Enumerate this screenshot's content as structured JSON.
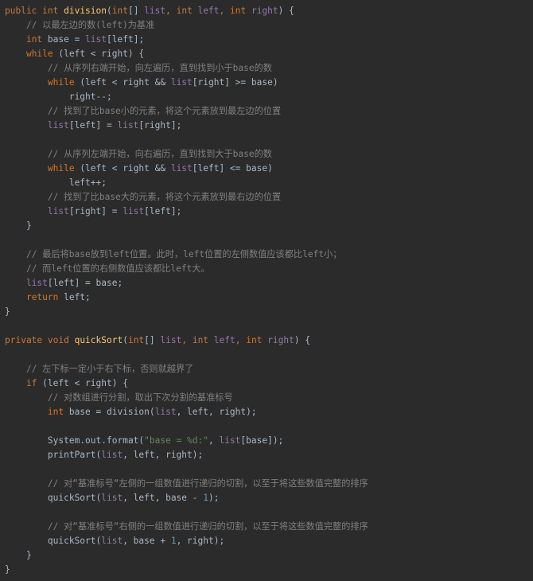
{
  "editor": {
    "lines": [
      {
        "indent": 0,
        "tokens": [
          {
            "t": "public ",
            "c": "kw"
          },
          {
            "t": "int ",
            "c": "kw"
          },
          {
            "t": "division",
            "c": "fn"
          },
          {
            "t": "(",
            "c": "punct"
          },
          {
            "t": "int",
            "c": "kw"
          },
          {
            "t": "[] ",
            "c": "punct"
          },
          {
            "t": "list",
            "c": "var"
          },
          {
            "t": ", ",
            "c": "kw"
          },
          {
            "t": "int ",
            "c": "kw"
          },
          {
            "t": "left",
            "c": "var"
          },
          {
            "t": ", ",
            "c": "kw"
          },
          {
            "t": "int ",
            "c": "kw"
          },
          {
            "t": "right",
            "c": "var"
          },
          {
            "t": ") {",
            "c": "punct"
          }
        ]
      },
      {
        "indent": 1,
        "tokens": [
          {
            "t": "// 以最左边的数(left)为基准",
            "c": "comment"
          }
        ]
      },
      {
        "indent": 1,
        "tokens": [
          {
            "t": "int ",
            "c": "kw"
          },
          {
            "t": "base = ",
            "c": "plain"
          },
          {
            "t": "list",
            "c": "var"
          },
          {
            "t": "[left];",
            "c": "plain"
          }
        ]
      },
      {
        "indent": 1,
        "tokens": [
          {
            "t": "while ",
            "c": "kw"
          },
          {
            "t": "(left < right) {",
            "c": "plain"
          }
        ]
      },
      {
        "indent": 2,
        "tokens": [
          {
            "t": "// 从序列右端开始，向左遍历，直到找到小于base的数",
            "c": "comment"
          }
        ]
      },
      {
        "indent": 2,
        "tokens": [
          {
            "t": "while ",
            "c": "kw"
          },
          {
            "t": "(left < right && ",
            "c": "plain"
          },
          {
            "t": "list",
            "c": "var"
          },
          {
            "t": "[right] >= base)",
            "c": "plain"
          }
        ]
      },
      {
        "indent": 3,
        "tokens": [
          {
            "t": "right--;",
            "c": "plain"
          }
        ]
      },
      {
        "indent": 2,
        "tokens": [
          {
            "t": "// 找到了比base小的元素，将这个元素放到最左边的位置",
            "c": "comment"
          }
        ]
      },
      {
        "indent": 2,
        "tokens": [
          {
            "t": "list",
            "c": "var"
          },
          {
            "t": "[left] = ",
            "c": "plain"
          },
          {
            "t": "list",
            "c": "var"
          },
          {
            "t": "[right];",
            "c": "plain"
          }
        ]
      },
      {
        "indent": 0,
        "tokens": []
      },
      {
        "indent": 2,
        "tokens": [
          {
            "t": "// 从序列左端开始，向右遍历，直到找到大于base的数",
            "c": "comment"
          }
        ]
      },
      {
        "indent": 2,
        "tokens": [
          {
            "t": "while ",
            "c": "kw"
          },
          {
            "t": "(left < right && ",
            "c": "plain"
          },
          {
            "t": "list",
            "c": "var"
          },
          {
            "t": "[left] <= base)",
            "c": "plain"
          }
        ]
      },
      {
        "indent": 3,
        "tokens": [
          {
            "t": "left++;",
            "c": "plain"
          }
        ]
      },
      {
        "indent": 2,
        "tokens": [
          {
            "t": "// 找到了比base大的元素，将这个元素放到最右边的位置",
            "c": "comment"
          }
        ]
      },
      {
        "indent": 2,
        "tokens": [
          {
            "t": "list",
            "c": "var"
          },
          {
            "t": "[right] = ",
            "c": "plain"
          },
          {
            "t": "list",
            "c": "var"
          },
          {
            "t": "[left];",
            "c": "plain"
          }
        ]
      },
      {
        "indent": 1,
        "tokens": [
          {
            "t": "}",
            "c": "plain"
          }
        ]
      },
      {
        "indent": 0,
        "tokens": []
      },
      {
        "indent": 1,
        "tokens": [
          {
            "t": "// 最后将base放到left位置。此时，left位置的左侧数值应该都比left小；",
            "c": "comment"
          }
        ]
      },
      {
        "indent": 1,
        "tokens": [
          {
            "t": "// 而left位置的右侧数值应该都比left大。",
            "c": "comment"
          }
        ]
      },
      {
        "indent": 1,
        "tokens": [
          {
            "t": "list",
            "c": "var"
          },
          {
            "t": "[left] = base;",
            "c": "plain"
          }
        ]
      },
      {
        "indent": 1,
        "tokens": [
          {
            "t": "return ",
            "c": "kw"
          },
          {
            "t": "left;",
            "c": "plain"
          }
        ]
      },
      {
        "indent": 0,
        "tokens": [
          {
            "t": "}",
            "c": "plain"
          }
        ]
      },
      {
        "indent": 0,
        "tokens": []
      },
      {
        "indent": 0,
        "tokens": [
          {
            "t": "private ",
            "c": "kw"
          },
          {
            "t": "void ",
            "c": "kw"
          },
          {
            "t": "quickSort",
            "c": "fn"
          },
          {
            "t": "(",
            "c": "punct"
          },
          {
            "t": "int",
            "c": "kw"
          },
          {
            "t": "[] ",
            "c": "punct"
          },
          {
            "t": "list",
            "c": "var"
          },
          {
            "t": ", ",
            "c": "kw"
          },
          {
            "t": "int ",
            "c": "kw"
          },
          {
            "t": "left",
            "c": "var"
          },
          {
            "t": ", ",
            "c": "kw"
          },
          {
            "t": "int ",
            "c": "kw"
          },
          {
            "t": "right",
            "c": "var"
          },
          {
            "t": ") {",
            "c": "punct"
          }
        ]
      },
      {
        "indent": 0,
        "tokens": []
      },
      {
        "indent": 1,
        "tokens": [
          {
            "t": "// 左下标一定小于右下标，否则就越界了",
            "c": "comment"
          }
        ]
      },
      {
        "indent": 1,
        "tokens": [
          {
            "t": "if ",
            "c": "kw"
          },
          {
            "t": "(left < right) {",
            "c": "plain"
          }
        ]
      },
      {
        "indent": 2,
        "tokens": [
          {
            "t": "// 对数组进行分割，取出下次分割的基准标号",
            "c": "comment"
          }
        ]
      },
      {
        "indent": 2,
        "tokens": [
          {
            "t": "int ",
            "c": "kw"
          },
          {
            "t": "base = division(",
            "c": "plain"
          },
          {
            "t": "list",
            "c": "var"
          },
          {
            "t": ", left, right);",
            "c": "plain"
          }
        ]
      },
      {
        "indent": 0,
        "tokens": []
      },
      {
        "indent": 2,
        "tokens": [
          {
            "t": "System.",
            "c": "plain"
          },
          {
            "t": "out",
            "c": "plain"
          },
          {
            "t": ".format(",
            "c": "plain"
          },
          {
            "t": "\"base = %d:\"",
            "c": "str"
          },
          {
            "t": ", ",
            "c": "plain"
          },
          {
            "t": "list",
            "c": "var"
          },
          {
            "t": "[base]);",
            "c": "plain"
          }
        ]
      },
      {
        "indent": 2,
        "tokens": [
          {
            "t": "printPart(",
            "c": "plain"
          },
          {
            "t": "list",
            "c": "var"
          },
          {
            "t": ", left, right);",
            "c": "plain"
          }
        ]
      },
      {
        "indent": 0,
        "tokens": []
      },
      {
        "indent": 2,
        "tokens": [
          {
            "t": "// 对“基准标号“左侧的一组数值进行递归的切割，以至于将这些数值完整的排序",
            "c": "comment"
          }
        ]
      },
      {
        "indent": 2,
        "tokens": [
          {
            "t": "quickSort(",
            "c": "plain"
          },
          {
            "t": "list",
            "c": "var"
          },
          {
            "t": ", left, base - ",
            "c": "plain"
          },
          {
            "t": "1",
            "c": "num"
          },
          {
            "t": ");",
            "c": "plain"
          }
        ]
      },
      {
        "indent": 0,
        "tokens": []
      },
      {
        "indent": 2,
        "tokens": [
          {
            "t": "// 对“基准标号“右侧的一组数值进行递归的切割，以至于将这些数值完整的排序",
            "c": "comment"
          }
        ]
      },
      {
        "indent": 2,
        "tokens": [
          {
            "t": "quickSort(",
            "c": "plain"
          },
          {
            "t": "list",
            "c": "var"
          },
          {
            "t": ", base + ",
            "c": "plain"
          },
          {
            "t": "1",
            "c": "num"
          },
          {
            "t": ", right);",
            "c": "plain"
          }
        ]
      },
      {
        "indent": 1,
        "tokens": [
          {
            "t": "}",
            "c": "plain"
          }
        ]
      },
      {
        "indent": 0,
        "tokens": [
          {
            "t": "}",
            "c": "plain"
          }
        ]
      }
    ]
  },
  "theme": {
    "background": "#2b2b2b",
    "keyword": "#cc7832",
    "function": "#ffc66d",
    "field": "#9876aa",
    "comment": "#808080",
    "number": "#6897bb",
    "string": "#6a8759",
    "text": "#a9b7c6"
  }
}
